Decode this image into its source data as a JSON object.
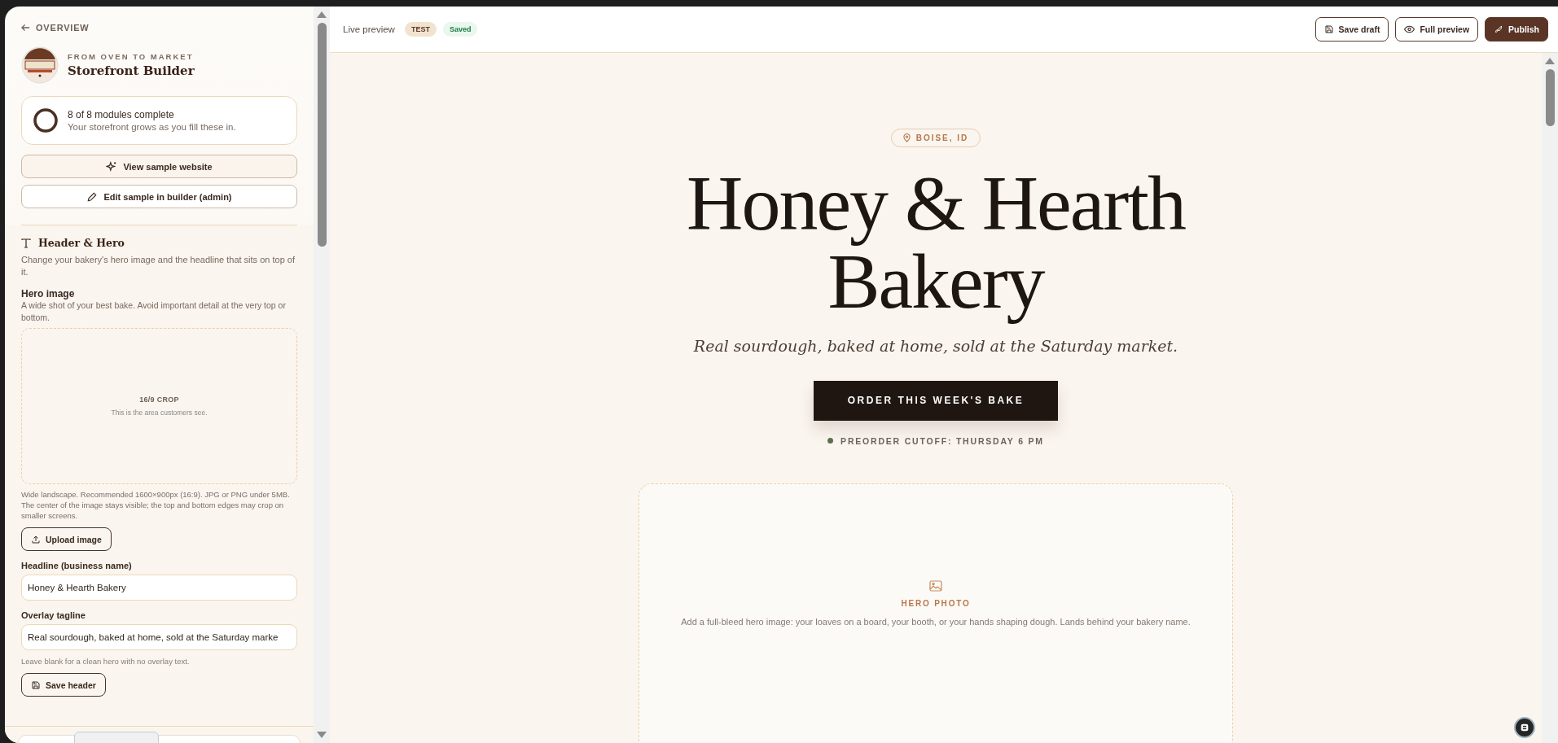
{
  "sidebar": {
    "back_link": "OVERVIEW",
    "brand": {
      "eyebrow": "FROM OVEN TO MARKET",
      "title": "Storefront Builder"
    },
    "progress": {
      "title": "8 of 8 modules complete",
      "subtitle": "Your storefront grows as you fill these in.",
      "level": 1
    },
    "buttons": [
      {
        "label": "View sample website",
        "kind": "sparkle"
      },
      {
        "label": "Edit sample in builder (admin)",
        "kind": "pencil"
      }
    ],
    "section": {
      "title": "Header & Hero",
      "description": "Change your bakery's hero image and the headline that sits on top of it.",
      "hero_image": {
        "label": "Hero image",
        "hint": "A wide shot of your best bake. Avoid important detail at the very top or bottom.",
        "crop_label": "16/9 CROP",
        "crop_note": "This is the area customers see.",
        "help": "Wide landscape. Recommended 1600×900px (16:9). JPG or PNG under 5MB. The center of the image stays visible; the top and bottom edges may crop on smaller screens.",
        "upload_button": "Upload image"
      },
      "fields": [
        {
          "label": "Headline (business name)",
          "value": "Honey & Hearth Bakery"
        },
        {
          "label": "Overlay tagline",
          "value": "Real sourdough, baked at home, sold at the Saturday marke",
          "hint": "Leave blank for a clean hero with no overlay text."
        }
      ],
      "save_button": "Save header"
    }
  },
  "toolbar": {
    "title": "Live preview",
    "badges": [
      {
        "label": "TEST",
        "kind": "env"
      },
      {
        "label": "Saved",
        "kind": "status"
      }
    ],
    "actions": [
      {
        "label": "Save draft",
        "kind": "save"
      },
      {
        "label": "Full preview",
        "kind": "eye"
      },
      {
        "label": "Publish",
        "kind": "rocket"
      }
    ]
  },
  "preview": {
    "location": "BOISE, ID",
    "headline_lines": [
      "Honey & Hearth",
      "Bakery"
    ],
    "tagline": "Real sourdough, baked at home, sold at the Saturday market.",
    "cta": "ORDER THIS WEEK'S BAKE",
    "cutoff": "PREORDER CUTOFF: THURSDAY 6 PM",
    "hero_placeholder": {
      "title": "HERO PHOTO",
      "text": "Add a full-bleed hero image: your loaves on a board, your booth, or your hands shaping dough. Lands behind your bakery name."
    }
  }
}
